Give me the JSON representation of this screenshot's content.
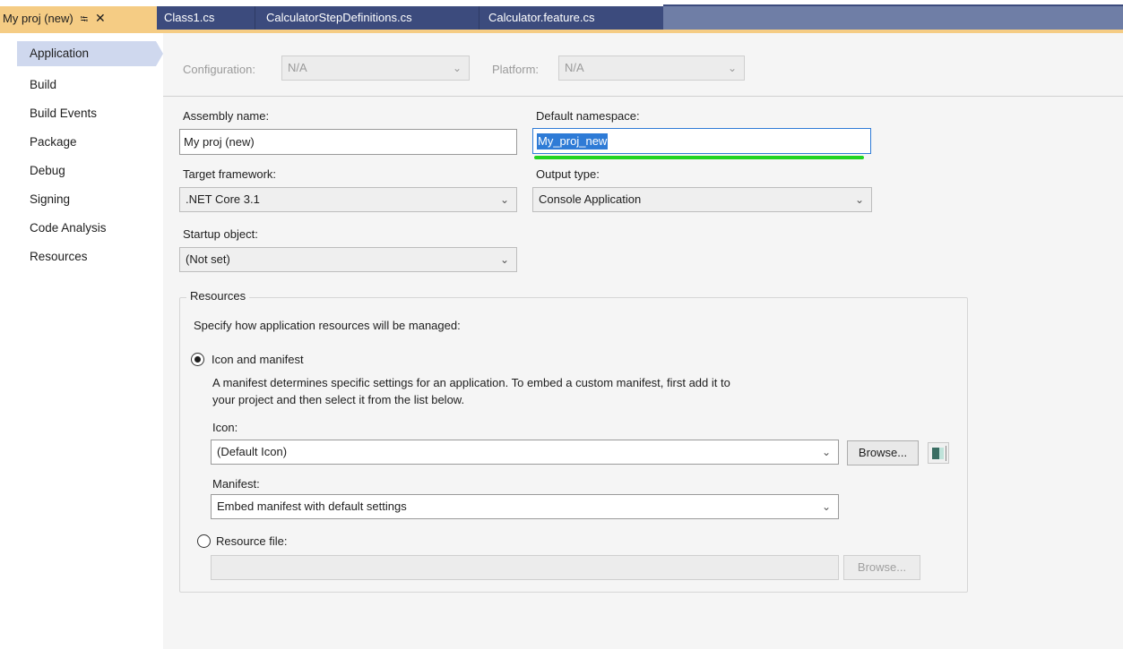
{
  "tabs": [
    {
      "label": "My proj (new)",
      "active": true
    },
    {
      "label": "Class1.cs"
    },
    {
      "label": "CalculatorStepDefinitions.cs"
    },
    {
      "label": "Calculator.feature.cs"
    }
  ],
  "nav": {
    "items": [
      {
        "label": "Application",
        "selected": true
      },
      {
        "label": "Build"
      },
      {
        "label": "Build Events"
      },
      {
        "label": "Package"
      },
      {
        "label": "Debug"
      },
      {
        "label": "Signing"
      },
      {
        "label": "Code Analysis"
      },
      {
        "label": "Resources"
      }
    ]
  },
  "config": {
    "configuration_label": "Configuration:",
    "configuration_value": "N/A",
    "platform_label": "Platform:",
    "platform_value": "N/A"
  },
  "form": {
    "assembly_name_label": "Assembly name:",
    "assembly_name_value": "My proj (new)",
    "default_namespace_label": "Default namespace:",
    "default_namespace_value": "My_proj_new",
    "target_framework_label": "Target framework:",
    "target_framework_value": ".NET Core 3.1",
    "output_type_label": "Output type:",
    "output_type_value": "Console Application",
    "startup_object_label": "Startup object:",
    "startup_object_value": "(Not set)"
  },
  "resources": {
    "title": "Resources",
    "description": "Specify how application resources will be managed:",
    "icon_manifest_label": "Icon and manifest",
    "icon_manifest_help_1": "A manifest determines specific settings for an application. To embed a custom manifest, first add it to",
    "icon_manifest_help_2": "your project and then select it from the list below.",
    "icon_label": "Icon:",
    "icon_value": "(Default Icon)",
    "browse_label": "Browse...",
    "manifest_label": "Manifest:",
    "manifest_value": "Embed manifest with default settings",
    "resource_file_label": "Resource file:",
    "resource_file_value": "",
    "resource_browse_label": "Browse..."
  },
  "icons": {
    "pin": "pin-icon",
    "close": "close-icon",
    "chevron": "chevron-down-icon",
    "icon_preview": "application-icon-preview"
  },
  "colors": {
    "active_tab": "#f5cc84",
    "tab_bar": "#3c4b7d",
    "selection": "#2e7bd6",
    "highlight_underline": "#22d422",
    "nav_selected": "#cfd8ee"
  }
}
